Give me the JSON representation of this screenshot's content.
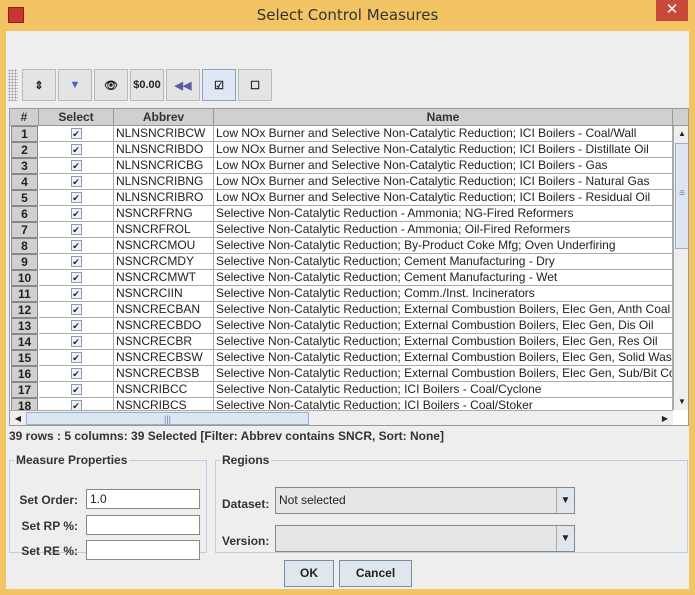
{
  "window": {
    "title": "Select Control Measures",
    "close": "✕"
  },
  "toolbar": {
    "buttons": [
      {
        "name": "sort-icon",
        "glyph": "⇕"
      },
      {
        "name": "filter-icon",
        "glyph": "▼"
      },
      {
        "name": "view-icon",
        "glyph": "👁"
      },
      {
        "name": "format-icon",
        "glyph": "$0.00"
      },
      {
        "name": "reset-icon",
        "glyph": "◀◀"
      },
      {
        "name": "select-all-icon",
        "glyph": "☑"
      },
      {
        "name": "clear-all-icon",
        "glyph": "☐"
      }
    ]
  },
  "table": {
    "columns": [
      "#",
      "Select",
      "Abbrev",
      "Name"
    ],
    "check": "✔",
    "rows": [
      [
        "1",
        "NLNSNCRIBCW",
        "Low NOx Burner and Selective Non-Catalytic Reduction; ICI Boilers - Coal/Wall"
      ],
      [
        "2",
        "NLNSNCRIBDO",
        "Low NOx Burner and Selective Non-Catalytic Reduction; ICI Boilers - Distillate Oil"
      ],
      [
        "3",
        "NLNSNCRICBG",
        "Low NOx Burner and Selective Non-Catalytic Reduction; ICI Boilers - Gas"
      ],
      [
        "4",
        "NLNSNCRIBNG",
        "Low NOx Burner and Selective Non-Catalytic Reduction; ICI Boilers - Natural Gas"
      ],
      [
        "5",
        "NLNSNCRIBRO",
        "Low NOx Burner and Selective Non-Catalytic Reduction; ICI Boilers - Residual Oil"
      ],
      [
        "6",
        "NSNCRFRNG",
        "Selective Non-Catalytic Reduction - Ammonia; NG-Fired Reformers"
      ],
      [
        "7",
        "NSNCRFROL",
        "Selective Non-Catalytic Reduction - Ammonia; Oil-Fired Reformers"
      ],
      [
        "8",
        "NSNCRCMOU",
        "Selective Non-Catalytic Reduction; By-Product Coke Mfg; Oven Underfiring"
      ],
      [
        "9",
        "NSNCRCMDY",
        "Selective Non-Catalytic Reduction; Cement Manufacturing - Dry"
      ],
      [
        "10",
        "NSNCRCMWT",
        "Selective Non-Catalytic Reduction; Cement Manufacturing - Wet"
      ],
      [
        "11",
        "NSNCRCIIN",
        "Selective Non-Catalytic Reduction; Comm./Inst. Incinerators"
      ],
      [
        "12",
        "NSNCRECBAN",
        "Selective Non-Catalytic Reduction; External Combustion Boilers, Elec Gen, Anth Coal"
      ],
      [
        "13",
        "NSNCRECBDO",
        "Selective Non-Catalytic Reduction; External Combustion Boilers, Elec Gen, Dis Oil"
      ],
      [
        "14",
        "NSNCRECBR",
        "Selective Non-Catalytic Reduction; External Combustion Boilers, Elec Gen, Res Oil"
      ],
      [
        "15",
        "NSNCRECBSW",
        "Selective Non-Catalytic Reduction; External Combustion Boilers, Elec Gen, Solid Waste"
      ],
      [
        "16",
        "NSNCRECBSB",
        "Selective Non-Catalytic Reduction; External Combustion Boilers, Elec Gen, Sub/Bit Coal"
      ],
      [
        "17",
        "NSNCRIBCC",
        "Selective Non-Catalytic Reduction; ICI Boilers - Coal/Cyclone"
      ],
      [
        "18",
        "NSNCRIBCS",
        "Selective Non-Catalytic Reduction; ICI Boilers - Coal/Stoker"
      ]
    ]
  },
  "status": "39 rows : 5 columns: 39 Selected [Filter: Abbrev contains SNCR, Sort: None]",
  "measure": {
    "title": "Measure Properties",
    "order_label": "Set Order:",
    "order_value": "1.0",
    "rp_label": "Set RP %:",
    "rp_value": "",
    "re_label": "Set RE %:",
    "re_value": ""
  },
  "regions": {
    "title": "Regions",
    "dataset_label": "Dataset:",
    "dataset_value": "Not selected",
    "version_label": "Version:",
    "version_value": ""
  },
  "buttons": {
    "ok": "OK",
    "cancel": "Cancel"
  }
}
